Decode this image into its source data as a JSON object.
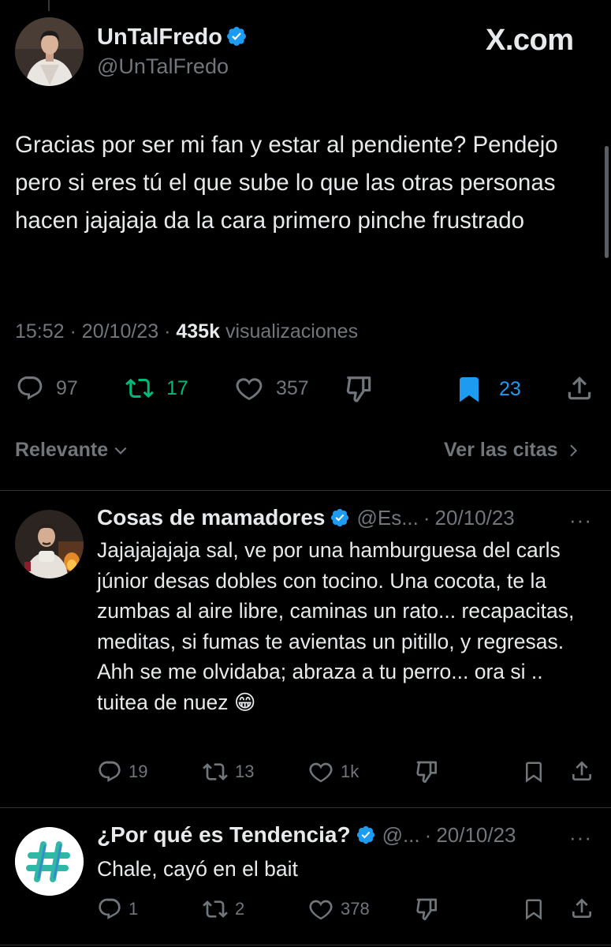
{
  "main_tweet": {
    "display_name": "UnTalFredo",
    "handle": "@UnTalFredo",
    "brand": "X.com",
    "text": "Gracias por ser mi fan y estar al pendiente? Pendejo pero si eres tú el que sube lo que las otras personas hacen jajajaja da la cara primero pinche frustrado",
    "time": "15:52",
    "date": "20/10/23",
    "views_count": "435k",
    "views_label": "visualizaciones",
    "separator": "·",
    "actions": {
      "replies": "97",
      "reposts": "17",
      "likes": "357",
      "bookmarks": "23"
    },
    "icons": [
      "reply-icon",
      "repost-icon",
      "like-icon",
      "dislike-icon",
      "bookmark-icon",
      "share-icon"
    ]
  },
  "sort": {
    "left_label": "Relevante",
    "right_label": "Ver las citas"
  },
  "replies": [
    {
      "display_name": "Cosas de mamadores",
      "handle": "@Es...",
      "date": "20/10/23",
      "separator": "·",
      "more": "···",
      "text": "Jajajajajaja sal, ve por una hamburguesa del carls júnior desas dobles con tocino. Una cocota, te la zumbas al aire libre, caminas un rato...  recapacitas, meditas, si fumas te avientas un pitillo, y regresas. Ahh se me olvidaba; abraza a tu perro... ora si .. tuitea de nuez",
      "emoji": "😁",
      "actions": {
        "replies": "19",
        "reposts": "13",
        "likes": "1k"
      }
    },
    {
      "display_name": "¿Por qué es Tendencia?",
      "handle": "@...",
      "date": "20/10/23",
      "separator": "·",
      "more": "···",
      "text": "Chale, cayó en el bait",
      "avatar_symbol": "#",
      "actions": {
        "replies": "1",
        "reposts": "2",
        "likes": "378"
      }
    }
  ],
  "colors": {
    "background": "#000000",
    "text": "#e7e9ea",
    "muted": "#71767b",
    "verified": "#1d9bf0",
    "repost_active": "#00ba7c",
    "bookmark_active": "#1d9bf0",
    "divider": "#2f3336"
  }
}
